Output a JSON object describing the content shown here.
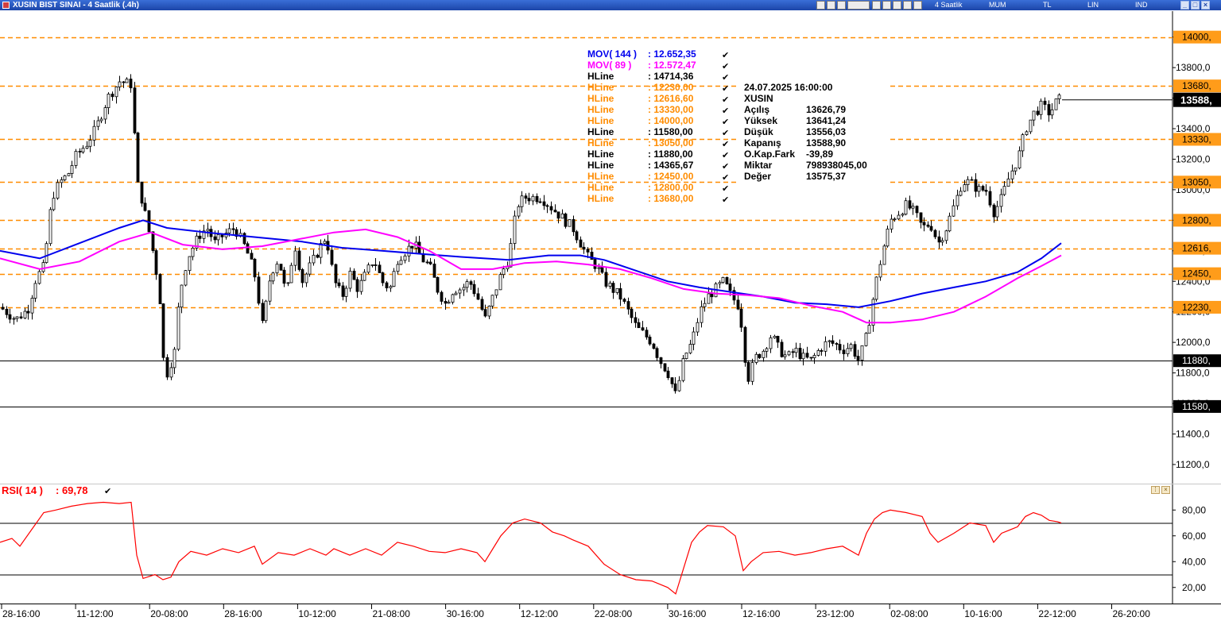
{
  "window": {
    "title": "XUSIN BIST SINAI - 4 Saatlik (.4h)",
    "toolbar_labels": [
      "4 Saatlik",
      "MUM",
      "TL",
      "LIN",
      "IND"
    ],
    "toolbar_icons": [
      "chart-icon",
      "print-icon",
      "zoom-icon",
      "period-select",
      "grid-icon",
      "settings-icon",
      "star-icon",
      "gear-icon",
      "arrow-icon"
    ],
    "controls": [
      "minimize",
      "restore",
      "close"
    ]
  },
  "colors": {
    "candle": "#000000",
    "mov144": "#0000ee",
    "mov89": "#ff00ff",
    "hline_orange": "#ff8c00",
    "hline_black": "#000000",
    "rsi": "#ff0000",
    "price_tag_orange": "#ff9c1a"
  },
  "legend": {
    "indicators": [
      {
        "name": "MOV( 144 )",
        "value": ": 12.652,35",
        "color": "#0000ee"
      },
      {
        "name": "MOV( 89 )",
        "value": ": 12.572,47",
        "color": "#ff00ff"
      },
      {
        "name": "HLine",
        "value": ": 14714,36",
        "color": "#000000"
      },
      {
        "name": "HLine",
        "value": ": 12230,00",
        "color": "#ff8c00"
      },
      {
        "name": "HLine",
        "value": ": 12616,60",
        "color": "#ff8c00"
      },
      {
        "name": "HLine",
        "value": ": 13330,00",
        "color": "#ff8c00"
      },
      {
        "name": "HLine",
        "value": ": 14000,00",
        "color": "#ff8c00"
      },
      {
        "name": "HLine",
        "value": ": 11580,00",
        "color": "#000000"
      },
      {
        "name": "HLine",
        "value": ": 13050,00",
        "color": "#ff8c00"
      },
      {
        "name": "HLine",
        "value": ": 11880,00",
        "color": "#000000"
      },
      {
        "name": "HLine",
        "value": ": 14365,67",
        "color": "#000000"
      },
      {
        "name": "HLine",
        "value": ": 12450,00",
        "color": "#ff8c00"
      },
      {
        "name": "HLine",
        "value": ": 12800,00",
        "color": "#ff8c00"
      },
      {
        "name": "HLine",
        "value": ": 13680,00",
        "color": "#ff8c00"
      }
    ],
    "check_mark": "✔"
  },
  "info": {
    "datetime": "24.07.2025  16:00:00",
    "symbol": "XUSIN",
    "rows": [
      {
        "label": "Açılış",
        "value": "13626,79"
      },
      {
        "label": "Yüksek",
        "value": "13641,24"
      },
      {
        "label": "Düşük",
        "value": "13556,03"
      },
      {
        "label": "Kapanış",
        "value": "13588,90"
      },
      {
        "label": "O.Kap.Fark",
        "value": "-39,89"
      },
      {
        "label": "Miktar",
        "value": "798938045,00"
      },
      {
        "label": "Değer",
        "value": "13575,37"
      }
    ]
  },
  "rsi_panel": {
    "label": "RSI( 14 )",
    "value": ": 69,78",
    "upper_level": 70,
    "lower_level": 30,
    "ticks": [
      "80,00",
      "60,00",
      "40,00",
      "20,00"
    ]
  },
  "chart_data": {
    "type": "candlestick",
    "y_range": [
      11080,
      14170
    ],
    "y_ticks": [
      {
        "v": 14000,
        "label": "14000,"
      },
      {
        "v": 13800,
        "label": "13800,0"
      },
      {
        "v": 13600,
        "label": "13600,0"
      },
      {
        "v": 13400,
        "label": "13400,0"
      },
      {
        "v": 13200,
        "label": "13200,0"
      },
      {
        "v": 13000,
        "label": "13000,0"
      },
      {
        "v": 12800,
        "label": "12800,0"
      },
      {
        "v": 12600,
        "label": "12600,0"
      },
      {
        "v": 12400,
        "label": "12400,0"
      },
      {
        "v": 12200,
        "label": "12200,0"
      },
      {
        "v": 12000,
        "label": "12000,0"
      },
      {
        "v": 11800,
        "label": "11800,0"
      },
      {
        "v": 11600,
        "label": "11600,0"
      },
      {
        "v": 11400,
        "label": "11400,0"
      },
      {
        "v": 11200,
        "label": "11200,0"
      }
    ],
    "x_labels": [
      "28-16:00",
      "11-12:00",
      "20-08:00",
      "28-16:00",
      "10-12:00",
      "21-08:00",
      "30-16:00",
      "12-12:00",
      "22-08:00",
      "30-16:00",
      "12-16:00",
      "23-12:00",
      "02-08:00",
      "10-16:00",
      "22-12:00",
      "26-20:00"
    ],
    "hlines": [
      {
        "value": 14000,
        "label": "14000,",
        "style": "dashed",
        "color": "#ff8c00"
      },
      {
        "value": 13680,
        "label": "13680,",
        "style": "dashed",
        "color": "#ff8c00"
      },
      {
        "value": 13330,
        "label": "13330,",
        "style": "dashed",
        "color": "#ff8c00"
      },
      {
        "value": 13050,
        "label": "13050,",
        "style": "dashed",
        "color": "#ff8c00"
      },
      {
        "value": 12800,
        "label": "12800,",
        "style": "dashed",
        "color": "#ff8c00"
      },
      {
        "value": 12616.6,
        "label": "12616,",
        "style": "dashed",
        "color": "#ff8c00"
      },
      {
        "value": 12450,
        "label": "12450,",
        "style": "dashed",
        "color": "#ff8c00"
      },
      {
        "value": 12230,
        "label": "12230,",
        "style": "dashed",
        "color": "#ff8c00"
      },
      {
        "value": 11880,
        "label": "11880,",
        "style": "solid",
        "color": "#000000"
      },
      {
        "value": 11580,
        "label": "11580,",
        "style": "solid",
        "color": "#000000"
      }
    ],
    "last_price": {
      "value": 13588.9,
      "label": "13588,"
    },
    "close_path": [
      [
        0,
        12230
      ],
      [
        20,
        12150
      ],
      [
        35,
        12220
      ],
      [
        45,
        12420
      ],
      [
        55,
        12500
      ],
      [
        65,
        12950
      ],
      [
        75,
        13050
      ],
      [
        85,
        13100
      ],
      [
        95,
        13220
      ],
      [
        110,
        13310
      ],
      [
        120,
        13400
      ],
      [
        135,
        13600
      ],
      [
        150,
        13710
      ],
      [
        165,
        13690
      ],
      [
        172,
        13050
      ],
      [
        180,
        12900
      ],
      [
        190,
        12650
      ],
      [
        200,
        12350
      ],
      [
        205,
        11900
      ],
      [
        210,
        11800
      ],
      [
        220,
        11950
      ],
      [
        225,
        12300
      ],
      [
        235,
        12550
      ],
      [
        250,
        12700
      ],
      [
        260,
        12750
      ],
      [
        270,
        12650
      ],
      [
        280,
        12700
      ],
      [
        295,
        12750
      ],
      [
        310,
        12600
      ],
      [
        320,
        12450
      ],
      [
        330,
        12100
      ],
      [
        340,
        12450
      ],
      [
        350,
        12550
      ],
      [
        360,
        12300
      ],
      [
        370,
        12650
      ],
      [
        380,
        12400
      ],
      [
        390,
        12500
      ],
      [
        400,
        12600
      ],
      [
        410,
        12700
      ],
      [
        420,
        12400
      ],
      [
        430,
        12300
      ],
      [
        440,
        12450
      ],
      [
        450,
        12350
      ],
      [
        460,
        12450
      ],
      [
        470,
        12550
      ],
      [
        480,
        12400
      ],
      [
        490,
        12350
      ],
      [
        500,
        12550
      ],
      [
        510,
        12600
      ],
      [
        520,
        12650
      ],
      [
        530,
        12550
      ],
      [
        540,
        12500
      ],
      [
        550,
        12350
      ],
      [
        560,
        12250
      ],
      [
        570,
        12350
      ],
      [
        580,
        12350
      ],
      [
        590,
        12400
      ],
      [
        600,
        12300
      ],
      [
        610,
        12150
      ],
      [
        620,
        12300
      ],
      [
        630,
        12450
      ],
      [
        640,
        12550
      ],
      [
        650,
        12900
      ],
      [
        660,
        12950
      ],
      [
        670,
        12950
      ],
      [
        680,
        12950
      ],
      [
        690,
        12900
      ],
      [
        700,
        12850
      ],
      [
        710,
        12800
      ],
      [
        720,
        12750
      ],
      [
        730,
        12650
      ],
      [
        740,
        12550
      ],
      [
        750,
        12500
      ],
      [
        760,
        12400
      ],
      [
        770,
        12350
      ],
      [
        780,
        12300
      ],
      [
        790,
        12200
      ],
      [
        800,
        12100
      ],
      [
        810,
        12050
      ],
      [
        820,
        12000
      ],
      [
        830,
        11880
      ],
      [
        840,
        11800
      ],
      [
        850,
        11650
      ],
      [
        860,
        11900
      ],
      [
        870,
        12000
      ],
      [
        880,
        12200
      ],
      [
        890,
        12300
      ],
      [
        900,
        12350
      ],
      [
        910,
        12400
      ],
      [
        920,
        12300
      ],
      [
        930,
        12230
      ],
      [
        940,
        11750
      ],
      [
        950,
        11900
      ],
      [
        960,
        11950
      ],
      [
        970,
        12050
      ],
      [
        980,
        11950
      ],
      [
        990,
        11900
      ],
      [
        1000,
        11950
      ],
      [
        1010,
        11900
      ],
      [
        1020,
        11880
      ],
      [
        1030,
        11950
      ],
      [
        1040,
        12000
      ],
      [
        1050,
        11990
      ],
      [
        1060,
        11950
      ],
      [
        1070,
        11980
      ],
      [
        1080,
        11880
      ],
      [
        1090,
        12050
      ],
      [
        1100,
        12350
      ],
      [
        1110,
        12600
      ],
      [
        1120,
        12800
      ],
      [
        1130,
        12850
      ],
      [
        1140,
        12900
      ],
      [
        1150,
        12850
      ],
      [
        1160,
        12750
      ],
      [
        1170,
        12780
      ],
      [
        1180,
        12650
      ],
      [
        1190,
        12750
      ],
      [
        1200,
        12900
      ],
      [
        1210,
        13050
      ],
      [
        1220,
        13050
      ],
      [
        1230,
        13000
      ],
      [
        1240,
        13000
      ],
      [
        1250,
        12850
      ],
      [
        1260,
        12950
      ],
      [
        1270,
        13100
      ],
      [
        1280,
        13200
      ],
      [
        1290,
        13400
      ],
      [
        1300,
        13500
      ],
      [
        1310,
        13550
      ],
      [
        1320,
        13500
      ],
      [
        1330,
        13590
      ]
    ],
    "mov144_path": [
      [
        0,
        12600
      ],
      [
        50,
        12550
      ],
      [
        100,
        12650
      ],
      [
        150,
        12750
      ],
      [
        180,
        12800
      ],
      [
        210,
        12750
      ],
      [
        260,
        12720
      ],
      [
        320,
        12690
      ],
      [
        380,
        12660
      ],
      [
        430,
        12620
      ],
      [
        480,
        12600
      ],
      [
        530,
        12580
      ],
      [
        580,
        12560
      ],
      [
        640,
        12540
      ],
      [
        690,
        12570
      ],
      [
        730,
        12570
      ],
      [
        760,
        12540
      ],
      [
        800,
        12470
      ],
      [
        840,
        12400
      ],
      [
        880,
        12360
      ],
      [
        920,
        12330
      ],
      [
        960,
        12300
      ],
      [
        1000,
        12260
      ],
      [
        1040,
        12250
      ],
      [
        1080,
        12230
      ],
      [
        1120,
        12270
      ],
      [
        1160,
        12320
      ],
      [
        1200,
        12360
      ],
      [
        1240,
        12400
      ],
      [
        1280,
        12460
      ],
      [
        1310,
        12550
      ],
      [
        1335,
        12650
      ]
    ],
    "mov89_path": [
      [
        0,
        12550
      ],
      [
        50,
        12480
      ],
      [
        100,
        12530
      ],
      [
        150,
        12660
      ],
      [
        190,
        12720
      ],
      [
        230,
        12640
      ],
      [
        280,
        12610
      ],
      [
        330,
        12630
      ],
      [
        380,
        12680
      ],
      [
        420,
        12720
      ],
      [
        460,
        12740
      ],
      [
        500,
        12690
      ],
      [
        540,
        12600
      ],
      [
        580,
        12480
      ],
      [
        620,
        12480
      ],
      [
        660,
        12520
      ],
      [
        700,
        12530
      ],
      [
        740,
        12510
      ],
      [
        780,
        12480
      ],
      [
        820,
        12420
      ],
      [
        860,
        12350
      ],
      [
        900,
        12320
      ],
      [
        940,
        12310
      ],
      [
        980,
        12290
      ],
      [
        1020,
        12240
      ],
      [
        1060,
        12200
      ],
      [
        1090,
        12130
      ],
      [
        1120,
        12130
      ],
      [
        1160,
        12150
      ],
      [
        1200,
        12200
      ],
      [
        1240,
        12300
      ],
      [
        1280,
        12420
      ],
      [
        1310,
        12500
      ],
      [
        1335,
        12570
      ]
    ],
    "rsi_path": [
      [
        0,
        55
      ],
      [
        15,
        58
      ],
      [
        25,
        52
      ],
      [
        40,
        65
      ],
      [
        55,
        78
      ],
      [
        70,
        80
      ],
      [
        90,
        83
      ],
      [
        110,
        85
      ],
      [
        130,
        86
      ],
      [
        150,
        85
      ],
      [
        165,
        86
      ],
      [
        172,
        45
      ],
      [
        180,
        27
      ],
      [
        195,
        30
      ],
      [
        205,
        26
      ],
      [
        215,
        28
      ],
      [
        225,
        40
      ],
      [
        240,
        48
      ],
      [
        260,
        45
      ],
      [
        280,
        50
      ],
      [
        300,
        47
      ],
      [
        320,
        52
      ],
      [
        330,
        38
      ],
      [
        350,
        47
      ],
      [
        370,
        45
      ],
      [
        390,
        50
      ],
      [
        410,
        45
      ],
      [
        420,
        50
      ],
      [
        440,
        45
      ],
      [
        460,
        50
      ],
      [
        480,
        45
      ],
      [
        500,
        55
      ],
      [
        520,
        52
      ],
      [
        540,
        48
      ],
      [
        560,
        47
      ],
      [
        580,
        50
      ],
      [
        600,
        47
      ],
      [
        610,
        40
      ],
      [
        620,
        50
      ],
      [
        630,
        60
      ],
      [
        645,
        70
      ],
      [
        660,
        73
      ],
      [
        680,
        70
      ],
      [
        695,
        63
      ],
      [
        710,
        60
      ],
      [
        720,
        57
      ],
      [
        740,
        52
      ],
      [
        760,
        38
      ],
      [
        780,
        30
      ],
      [
        800,
        26
      ],
      [
        820,
        25
      ],
      [
        840,
        20
      ],
      [
        850,
        15
      ],
      [
        860,
        35
      ],
      [
        870,
        55
      ],
      [
        880,
        63
      ],
      [
        890,
        68
      ],
      [
        910,
        67
      ],
      [
        925,
        60
      ],
      [
        935,
        33
      ],
      [
        945,
        40
      ],
      [
        960,
        47
      ],
      [
        980,
        48
      ],
      [
        1000,
        45
      ],
      [
        1020,
        47
      ],
      [
        1040,
        50
      ],
      [
        1060,
        52
      ],
      [
        1080,
        45
      ],
      [
        1090,
        62
      ],
      [
        1100,
        73
      ],
      [
        1110,
        78
      ],
      [
        1120,
        80
      ],
      [
        1140,
        78
      ],
      [
        1160,
        75
      ],
      [
        1170,
        62
      ],
      [
        1180,
        55
      ],
      [
        1200,
        62
      ],
      [
        1220,
        70
      ],
      [
        1240,
        68
      ],
      [
        1250,
        55
      ],
      [
        1260,
        62
      ],
      [
        1280,
        67
      ],
      [
        1290,
        75
      ],
      [
        1300,
        78
      ],
      [
        1310,
        76
      ],
      [
        1320,
        72
      ],
      [
        1330,
        71
      ],
      [
        1335,
        70
      ]
    ]
  }
}
